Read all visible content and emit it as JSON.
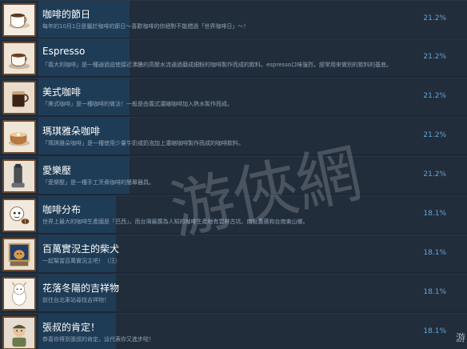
{
  "achievements": [
    {
      "icon": "coffee-cup-icon",
      "title": "咖啡的節日",
      "description": "每年的10月1日是屬於咖啡的節日～喜歡咖啡的你絕對不能錯過「世界咖啡日」～！",
      "percent": "21.2%",
      "progress": 0.212
    },
    {
      "icon": "espresso-icon",
      "title": "Espresso",
      "description": "「義大利咖啡」是一種通過迫使接近沸騰的高壓水流通過磨成細粉的咖啡製作而成的飲料。espresso口味強烈，經常用來做別的飲料的基底。",
      "percent": "21.2%",
      "progress": 0.212
    },
    {
      "icon": "americano-icon",
      "title": "美式咖啡",
      "description": "「美式咖啡」是一種咖啡的做法！一般是由義式濃縮咖啡加入熱水製作而成。",
      "percent": "21.2%",
      "progress": 0.212
    },
    {
      "icon": "macchiato-icon",
      "title": "瑪琪雅朵咖啡",
      "description": "「瑪琪雅朵咖啡」是一種使用少量牛奶或奶泡加上濃縮咖啡製作而成的咖啡飲料。",
      "percent": "21.2%",
      "progress": 0.212
    },
    {
      "icon": "aeropress-icon",
      "title": "愛樂壓",
      "description": "「愛樂壓」是一種手工烹煮咖啡的簡單器具。",
      "percent": "21.2%",
      "progress": 0.212
    },
    {
      "icon": "coffee-distribution-icon",
      "title": "咖啡分布",
      "description": "世界上最大的咖啡生產國是「巴西」，而台灣最廣為人知的咖啡生產地有雲林古坑、南投惠蓀和台南東山鄉。",
      "percent": "18.1%",
      "progress": 0.181
    },
    {
      "icon": "dog-frame-icon",
      "title": "百萬實況主的柴犬",
      "description": "一起幫當百萬實況主吧！（汪）",
      "percent": "18.1%",
      "progress": 0.181
    },
    {
      "icon": "mascot-icon",
      "title": "花落冬陽的吉祥物",
      "description": "前往台北車站尋找吉祥物！",
      "percent": "18.1%",
      "progress": 0.181
    },
    {
      "icon": "uncle-icon",
      "title": "張叔的肯定！",
      "description": "恭喜你得到張叔的肯定，這代表你又進步啦！",
      "percent": "18.1%",
      "progress": 0.181
    }
  ],
  "watermark": "游俠網",
  "edge_glyph": "游",
  "colors": {
    "background": "#1b2838",
    "row": "#222d3b",
    "progress": "#1e3f5c",
    "percent": "#62a6d9",
    "icon_frame": "#6b4a2f"
  }
}
